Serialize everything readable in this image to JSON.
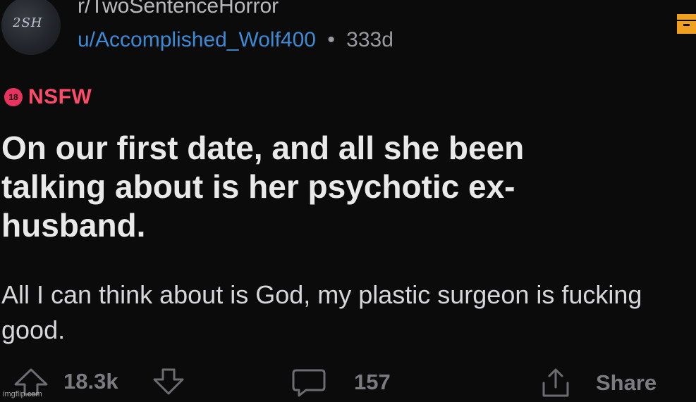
{
  "header": {
    "subreddit": "r/TwoSentenceHorror",
    "author": "u/Accomplished_Wolf400",
    "separator": "•",
    "age": "333d",
    "avatar_text": "2SH"
  },
  "tag": {
    "badge": "18",
    "label": "NSFW"
  },
  "post": {
    "title": "On our first date, and all she been talking about is her psychotic ex-husband.",
    "body": "All I can think about is God, my plastic surgeon is fucking good."
  },
  "actions": {
    "score": "18.3k",
    "comments": "157",
    "share": "Share"
  },
  "watermark": "imgflip.com",
  "colors": {
    "background": "#0b0b0c",
    "author": "#3d8bd6",
    "nsfw": "#ff4a6a",
    "save_icon": "#f0a01e"
  },
  "icons": [
    "upvote-icon",
    "downvote-icon",
    "comment-icon",
    "share-icon",
    "save-icon"
  ]
}
